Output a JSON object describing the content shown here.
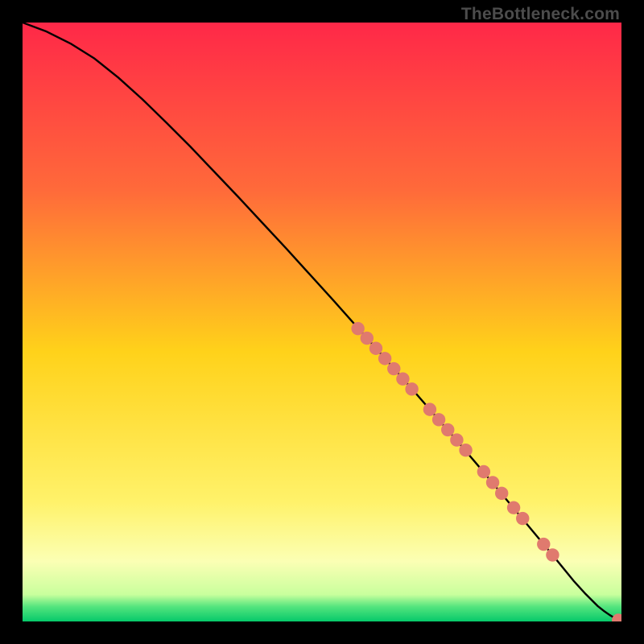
{
  "watermark": "TheBottleneck.com",
  "colors": {
    "page_bg": "#000000",
    "curve": "#000000",
    "point_fill": "#e07a6e",
    "point_stroke": "#d86a5d",
    "gradient_stops": [
      {
        "offset": 0.0,
        "color": "#ff2848"
      },
      {
        "offset": 0.28,
        "color": "#ff6a3a"
      },
      {
        "offset": 0.55,
        "color": "#ffd21a"
      },
      {
        "offset": 0.8,
        "color": "#fff26a"
      },
      {
        "offset": 0.9,
        "color": "#fbffb4"
      },
      {
        "offset": 0.955,
        "color": "#c9ff9d"
      },
      {
        "offset": 0.975,
        "color": "#55e57e"
      },
      {
        "offset": 1.0,
        "color": "#06c96a"
      }
    ]
  },
  "chart_data": {
    "type": "line",
    "title": "",
    "xlabel": "",
    "ylabel": "",
    "xlim": [
      0,
      100
    ],
    "ylim": [
      0,
      100
    ],
    "grid": false,
    "legend": false,
    "series": [
      {
        "name": "curve",
        "x": [
          0,
          4,
          8,
          12,
          16,
          20,
          24,
          28,
          32,
          36,
          40,
          44,
          48,
          52,
          56,
          60,
          64,
          68,
          72,
          76,
          80,
          84,
          88,
          92,
          94,
          96,
          97,
          98,
          99,
          100
        ],
        "y": [
          100,
          98.5,
          96.5,
          94,
          90.8,
          87.2,
          83.3,
          79.3,
          75.1,
          70.9,
          66.6,
          62.3,
          57.9,
          53.5,
          49.0,
          44.5,
          40.0,
          35.4,
          30.8,
          26.1,
          21.3,
          16.5,
          11.7,
          6.8,
          4.6,
          2.6,
          1.8,
          1.1,
          0.5,
          0.0
        ]
      },
      {
        "name": "points",
        "type": "scatter",
        "x": [
          56,
          57.5,
          59,
          60.5,
          62,
          63.5,
          65,
          68,
          69.5,
          71,
          72.5,
          74,
          77,
          78.5,
          80,
          82,
          83.5,
          87,
          88.5,
          99.5
        ],
        "y": [
          48.9,
          47.3,
          45.6,
          43.9,
          42.2,
          40.5,
          38.8,
          35.4,
          33.7,
          32.0,
          30.3,
          28.6,
          25.0,
          23.2,
          21.4,
          19.0,
          17.2,
          12.9,
          11.1,
          0.2
        ]
      }
    ]
  }
}
